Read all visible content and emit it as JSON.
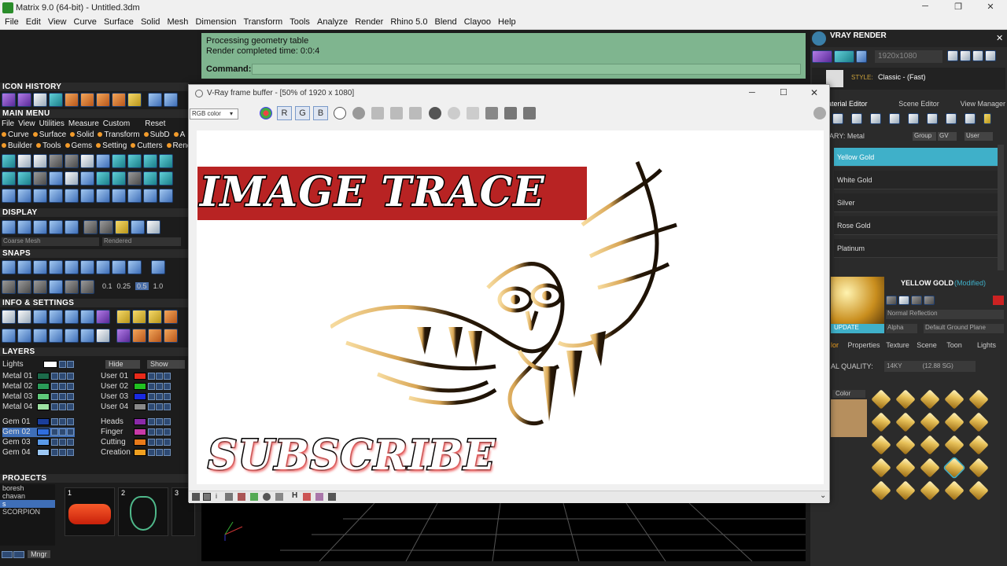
{
  "window": {
    "title": "Matrix 9.0 (64-bit) - Untitled.3dm",
    "min": "─",
    "max": "❐",
    "close": "✕"
  },
  "menu": [
    "File",
    "Edit",
    "View",
    "Curve",
    "Surface",
    "Solid",
    "Mesh",
    "Dimension",
    "Transform",
    "Tools",
    "Analyze",
    "Render",
    "Rhino 5.0",
    "Blend",
    "Clayoo",
    "Help"
  ],
  "left": {
    "icon_history": "ICON HISTORY",
    "main_menu": "MAIN MENU",
    "main_menu_row1": [
      "File",
      "View",
      "Utilities",
      "Measure",
      "Custom"
    ],
    "reset": "Reset",
    "main_menu_row2": [
      "Curve",
      "Surface",
      "Solid",
      "Transform",
      "SubD",
      "A"
    ],
    "main_menu_row3": [
      "Builder",
      "Tools",
      "Gems",
      "Setting",
      "Cutters",
      "Rend"
    ],
    "display": "DISPLAY",
    "display_mesh": "Coarse Mesh",
    "display_mode": "Rendered",
    "snaps": "SNAPS",
    "snap_values": [
      "0.1",
      "0.25",
      "0.5",
      "1.0"
    ],
    "info": "INFO & SETTINGS",
    "layers": "LAYERS",
    "lights": "Lights",
    "hide": "Hide",
    "show": "Show",
    "layer_left": [
      "Metal 01",
      "Metal 02",
      "Metal 03",
      "Metal 04",
      "Gem 01",
      "Gem 02",
      "Gem 03",
      "Gem 04"
    ],
    "layer_right": [
      "User 01",
      "User 02",
      "User 03",
      "User 04",
      "Heads",
      "Finger",
      "Cutting",
      "Creation"
    ],
    "projects": "PROJECTS",
    "project_list": [
      "boresh",
      "chavan",
      "s",
      "SCORPION"
    ],
    "thumbs": [
      "1",
      "2",
      "3"
    ],
    "mngr": "Mngr"
  },
  "command": {
    "line1": "Processing geometry table",
    "line2": "Render completed time: 0:0:4",
    "prompt": "Command:"
  },
  "vfb": {
    "title": "V-Ray frame buffer - [50% of 1920 x 1080]",
    "channel": "RGB color",
    "r": "R",
    "g": "G",
    "b": "B",
    "banner_text": "IMAGE TRACE",
    "subscribe_text": "SUBSCRIBE"
  },
  "right": {
    "vray_title": "VRAY RENDER",
    "resolution": "1920x1080",
    "style_label": "STYLE:",
    "style_value": "Classic - (Fast)",
    "tabs": [
      "aterial Editor",
      "Scene Editor",
      "View Manager"
    ],
    "library": "ARY: Metal",
    "group": "Group",
    "gv": "GV",
    "user": "User",
    "materials": [
      "Yellow Gold",
      "White Gold",
      "Silver",
      "Rose Gold",
      "Platinum"
    ],
    "mat_name": "YELLOW GOLD",
    "modified": "(Modified)",
    "reflection": "Normal Reflection",
    "update": "UPDATE",
    "alpha": "Alpha",
    "ground": "Default Ground Plane",
    "prop_tabs": [
      "lor",
      "Properties",
      "Texture",
      "Scene",
      "Toon",
      "Lights"
    ],
    "quality_label": "AL QUALITY:",
    "quality_value": "14KY",
    "quality_note": "(12.88 SG)",
    "color_label": "Color"
  }
}
